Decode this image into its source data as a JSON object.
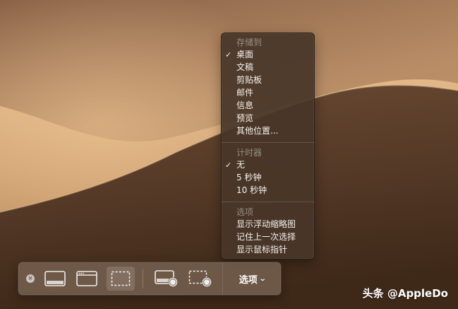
{
  "options_menu": {
    "save_to_header": "存储到",
    "save_to_items": [
      {
        "label": "桌面",
        "checked": true
      },
      {
        "label": "文稿",
        "checked": false
      },
      {
        "label": "剪贴板",
        "checked": false
      },
      {
        "label": "邮件",
        "checked": false
      },
      {
        "label": "信息",
        "checked": false
      },
      {
        "label": "预览",
        "checked": false
      },
      {
        "label": "其他位置...",
        "checked": false
      }
    ],
    "timer_header": "计时器",
    "timer_items": [
      {
        "label": "无",
        "checked": true
      },
      {
        "label": "5 秒钟",
        "checked": false
      },
      {
        "label": "10 秒钟",
        "checked": false
      }
    ],
    "options_header": "选项",
    "options_items": [
      {
        "label": "显示浮动缩略图",
        "checked": false
      },
      {
        "label": "记住上一次选择",
        "checked": false
      },
      {
        "label": "显示鼠标指针",
        "checked": false
      }
    ],
    "checkmark": "✓"
  },
  "toolbar": {
    "close_glyph": "×",
    "buttons": [
      {
        "name": "capture-entire-screen",
        "icon": "screen-icon",
        "selected": false
      },
      {
        "name": "capture-selected-window",
        "icon": "window-icon",
        "selected": false
      },
      {
        "name": "capture-selected-portion",
        "icon": "dashed-selection-icon",
        "selected": true
      },
      {
        "name": "record-entire-screen",
        "icon": "screen-record-icon",
        "selected": false
      },
      {
        "name": "record-selected-portion",
        "icon": "selection-record-icon",
        "selected": false
      }
    ],
    "options_label": "选项",
    "options_chevron": "⌄"
  },
  "watermark": "头条 @AppleDo",
  "colors": {
    "menu_bg": "#483628",
    "toolbar_bg": "#786250",
    "sand_light": "#d9ae7f",
    "sand_dark": "#3e2818"
  }
}
